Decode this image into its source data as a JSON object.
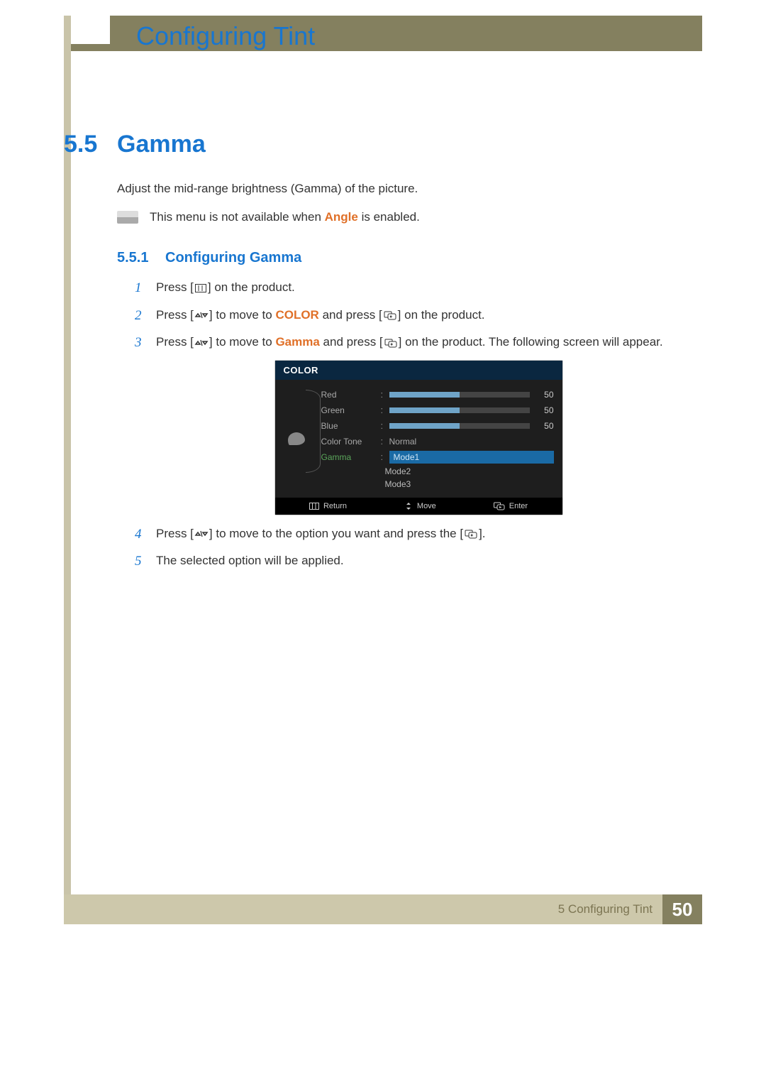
{
  "header": {
    "chapter_title": "Configuring Tint"
  },
  "section": {
    "number": "5.5",
    "title": "Gamma",
    "intro": "Adjust the mid-range brightness (Gamma) of the picture.",
    "note_pre": "This menu is not available when ",
    "note_highlight": "Angle",
    "note_post": " is enabled."
  },
  "subsection": {
    "number": "5.5.1",
    "title": "Configuring Gamma"
  },
  "steps": {
    "s1": {
      "n": "1",
      "a": "Press [",
      "b": "] on the product."
    },
    "s2": {
      "n": "2",
      "a": "Press [",
      "b": "] to move to ",
      "kw": "COLOR",
      "c": " and press [",
      "d": "] on the product."
    },
    "s3": {
      "n": "3",
      "a": "Press [",
      "b": "] to move to ",
      "kw": "Gamma",
      "c": " and press [",
      "d": "] on the product. The following screen will appear."
    },
    "s4": {
      "n": "4",
      "a": "Press [",
      "b": "] to move to the option you want and press the [",
      "c": "]."
    },
    "s5": {
      "n": "5",
      "a": "The selected option will be applied."
    }
  },
  "osd": {
    "title": "COLOR",
    "rows": {
      "red": {
        "label": "Red",
        "val": "50"
      },
      "green": {
        "label": "Green",
        "val": "50"
      },
      "blue": {
        "label": "Blue",
        "val": "50"
      },
      "color_tone": {
        "label": "Color Tone",
        "value": "Normal"
      },
      "gamma": {
        "label": "Gamma",
        "selected": "Mode1",
        "opt2": "Mode2",
        "opt3": "Mode3"
      }
    },
    "footer": {
      "return": "Return",
      "move": "Move",
      "enter": "Enter"
    }
  },
  "footer": {
    "label": "5 Configuring Tint",
    "page": "50"
  },
  "chart_data": {
    "type": "table",
    "title": "COLOR OSD values",
    "rows": [
      {
        "item": "Red",
        "value": 50
      },
      {
        "item": "Green",
        "value": 50
      },
      {
        "item": "Blue",
        "value": 50
      },
      {
        "item": "Color Tone",
        "value": "Normal"
      },
      {
        "item": "Gamma",
        "value": "Mode1",
        "options": [
          "Mode1",
          "Mode2",
          "Mode3"
        ]
      }
    ]
  }
}
